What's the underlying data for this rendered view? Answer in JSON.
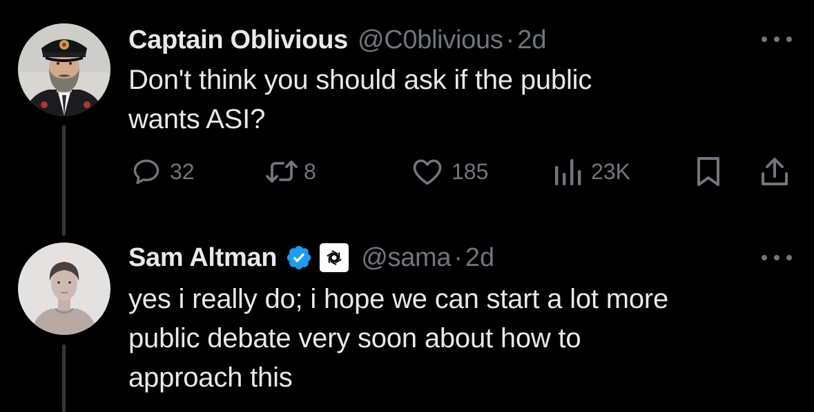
{
  "colors": {
    "background": "#000000",
    "primary_text": "#e7e9ea",
    "secondary_text": "#71767b",
    "verified_blue": "#1d9bf0",
    "thread_line": "#333639"
  },
  "tweets": [
    {
      "display_name": "Captain Oblivious",
      "handle": "@C0blivious",
      "separator": "·",
      "time": "2d",
      "text_lines": [
        "Don't think you should ask if the public",
        "wants ASI?"
      ],
      "avatar_icon": "captain-avatar",
      "actions": {
        "reply": {
          "icon": "reply-icon",
          "count": "32"
        },
        "retweet": {
          "icon": "retweet-icon",
          "count": "8"
        },
        "like": {
          "icon": "heart-icon",
          "count": "185"
        },
        "views": {
          "icon": "views-icon",
          "count": "23K"
        },
        "bookmark": {
          "icon": "bookmark-icon"
        },
        "share": {
          "icon": "share-icon"
        }
      }
    },
    {
      "display_name": "Sam Altman",
      "handle": "@sama",
      "separator": "·",
      "time": "2d",
      "verified": true,
      "affiliate_badge_icon": "openai-logo-icon",
      "text_lines": [
        "yes i really do; i hope we can start a lot more",
        "public debate very soon about how to",
        "approach this"
      ],
      "avatar_icon": "sam-avatar"
    }
  ]
}
